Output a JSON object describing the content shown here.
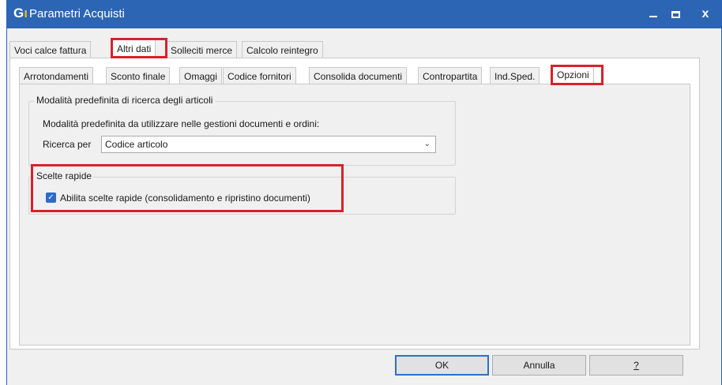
{
  "window": {
    "title": "Parametri Acquisti",
    "icon": "G1",
    "controls": {
      "minimize": "minimize-icon",
      "maximize": "maximize-icon",
      "close": "x"
    }
  },
  "outer_tabs": [
    "Voci calce fattura",
    "Altri dati",
    "Solleciti merce",
    "Calcolo reintegro"
  ],
  "outer_active": "Altri dati",
  "inner_tabs": [
    "Arrotondamenti",
    "Sconto finale",
    "Omaggi",
    "Codice fornitori",
    "Consolida documenti",
    "Contropartita",
    "Ind.Sped.",
    "Opzioni"
  ],
  "inner_active": "Opzioni",
  "search_group": {
    "title": "Modalità predefinita di ricerca degli articoli",
    "description": "Modalità predefinita da utilizzare nelle gestioni documenti e ordini:",
    "field_label": "Ricerca per",
    "field_value": "Codice articolo"
  },
  "quick_group": {
    "title": "Scelte rapide",
    "checkbox_label": "Abilita scelte rapide (consolidamento e ripristino documenti)",
    "checked": true
  },
  "buttons": {
    "ok": "OK",
    "cancel": "Annulla",
    "help": "?"
  },
  "colors": {
    "titlebar": "#2b65b4",
    "highlight": "#d7222b",
    "accent": "#2d6bc7"
  }
}
